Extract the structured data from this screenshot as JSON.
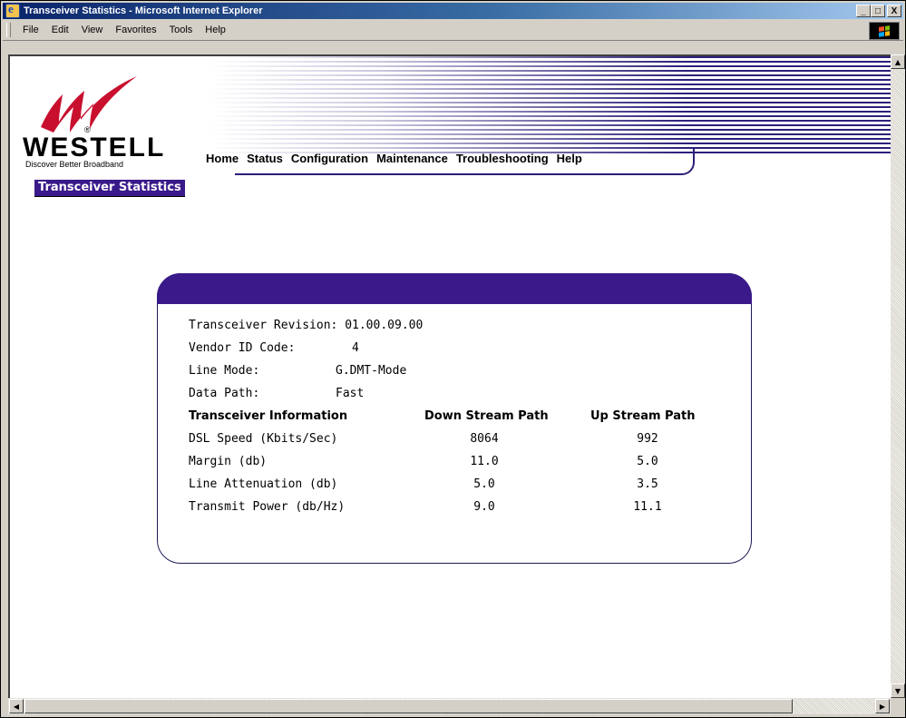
{
  "window": {
    "title": "Transceiver Statistics - Microsoft Internet Explorer",
    "min": "_",
    "max": "□",
    "close": "X"
  },
  "menu": {
    "file": "File",
    "edit": "Edit",
    "view": "View",
    "favorites": "Favorites",
    "tools": "Tools",
    "help": "Help"
  },
  "logo": {
    "brand": "WESTELL",
    "tagline": "Discover Better Broadband",
    "registered": "®"
  },
  "nav": {
    "home": "Home",
    "status": "Status",
    "configuration": "Configuration",
    "maintenance": "Maintenance",
    "troubleshooting": "Troubleshooting",
    "help": "Help"
  },
  "section_title": "Transceiver Statistics",
  "info": {
    "revision_label": "Transceiver Revision:",
    "revision_value": "01.00.09.00",
    "vendor_label": "Vendor ID Code:",
    "vendor_value": "4",
    "linemode_label": "Line Mode:",
    "linemode_value": "G.DMT-Mode",
    "datapath_label": "Data Path:",
    "datapath_value": "Fast"
  },
  "table": {
    "headers": [
      "Transceiver Information",
      "Down Stream Path",
      "Up Stream Path"
    ],
    "rows": [
      {
        "label": "DSL Speed (Kbits/Sec)",
        "down": "8064",
        "up": "992"
      },
      {
        "label": "Margin (db)",
        "down": "11.0",
        "up": "5.0"
      },
      {
        "label": "Line Attenuation (db)",
        "down": "5.0",
        "up": "3.5"
      },
      {
        "label": "Transmit Power (db/Hz)",
        "down": "9.0",
        "up": "11.1"
      }
    ]
  },
  "colors": {
    "accent": "#3a1a8a",
    "titlebar": "#0a246a"
  }
}
